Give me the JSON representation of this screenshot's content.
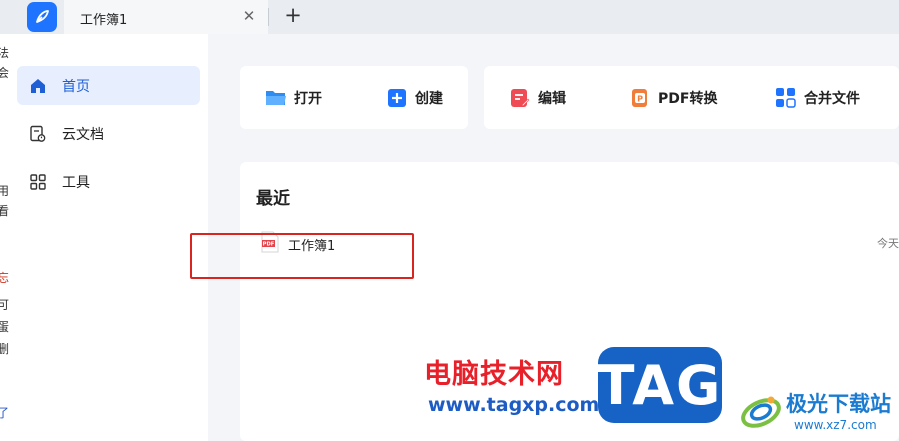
{
  "tabs": [
    {
      "title": "工作簿1"
    }
  ],
  "sidebar": {
    "items": [
      {
        "label": "首页",
        "active": true
      },
      {
        "label": "云文档",
        "active": false
      },
      {
        "label": "工具",
        "active": false
      }
    ]
  },
  "actions": {
    "open": "打开",
    "create": "创建",
    "edit": "编辑",
    "pdf_convert": "PDF转换",
    "merge": "合并文件"
  },
  "recent": {
    "title": "最近",
    "files": [
      {
        "name": "工作簿1",
        "time": "今天",
        "type": "PDF"
      }
    ]
  },
  "watermarks": {
    "site_cn": "电脑技术网",
    "site_url": "www.tagxp.com",
    "tag": "TAG",
    "site2_cn": "极光下载站",
    "site2_url": "www.xz7.com"
  },
  "background_window": {
    "glyphs": [
      "法",
      "会",
      "用",
      "看",
      "忘",
      "可",
      "蛋",
      "删",
      "了"
    ]
  },
  "colors": {
    "accent": "#1f74ff",
    "highlight": "#d9251f",
    "watermark_red": "#e8202a",
    "watermark_blue": "#1763c5"
  }
}
